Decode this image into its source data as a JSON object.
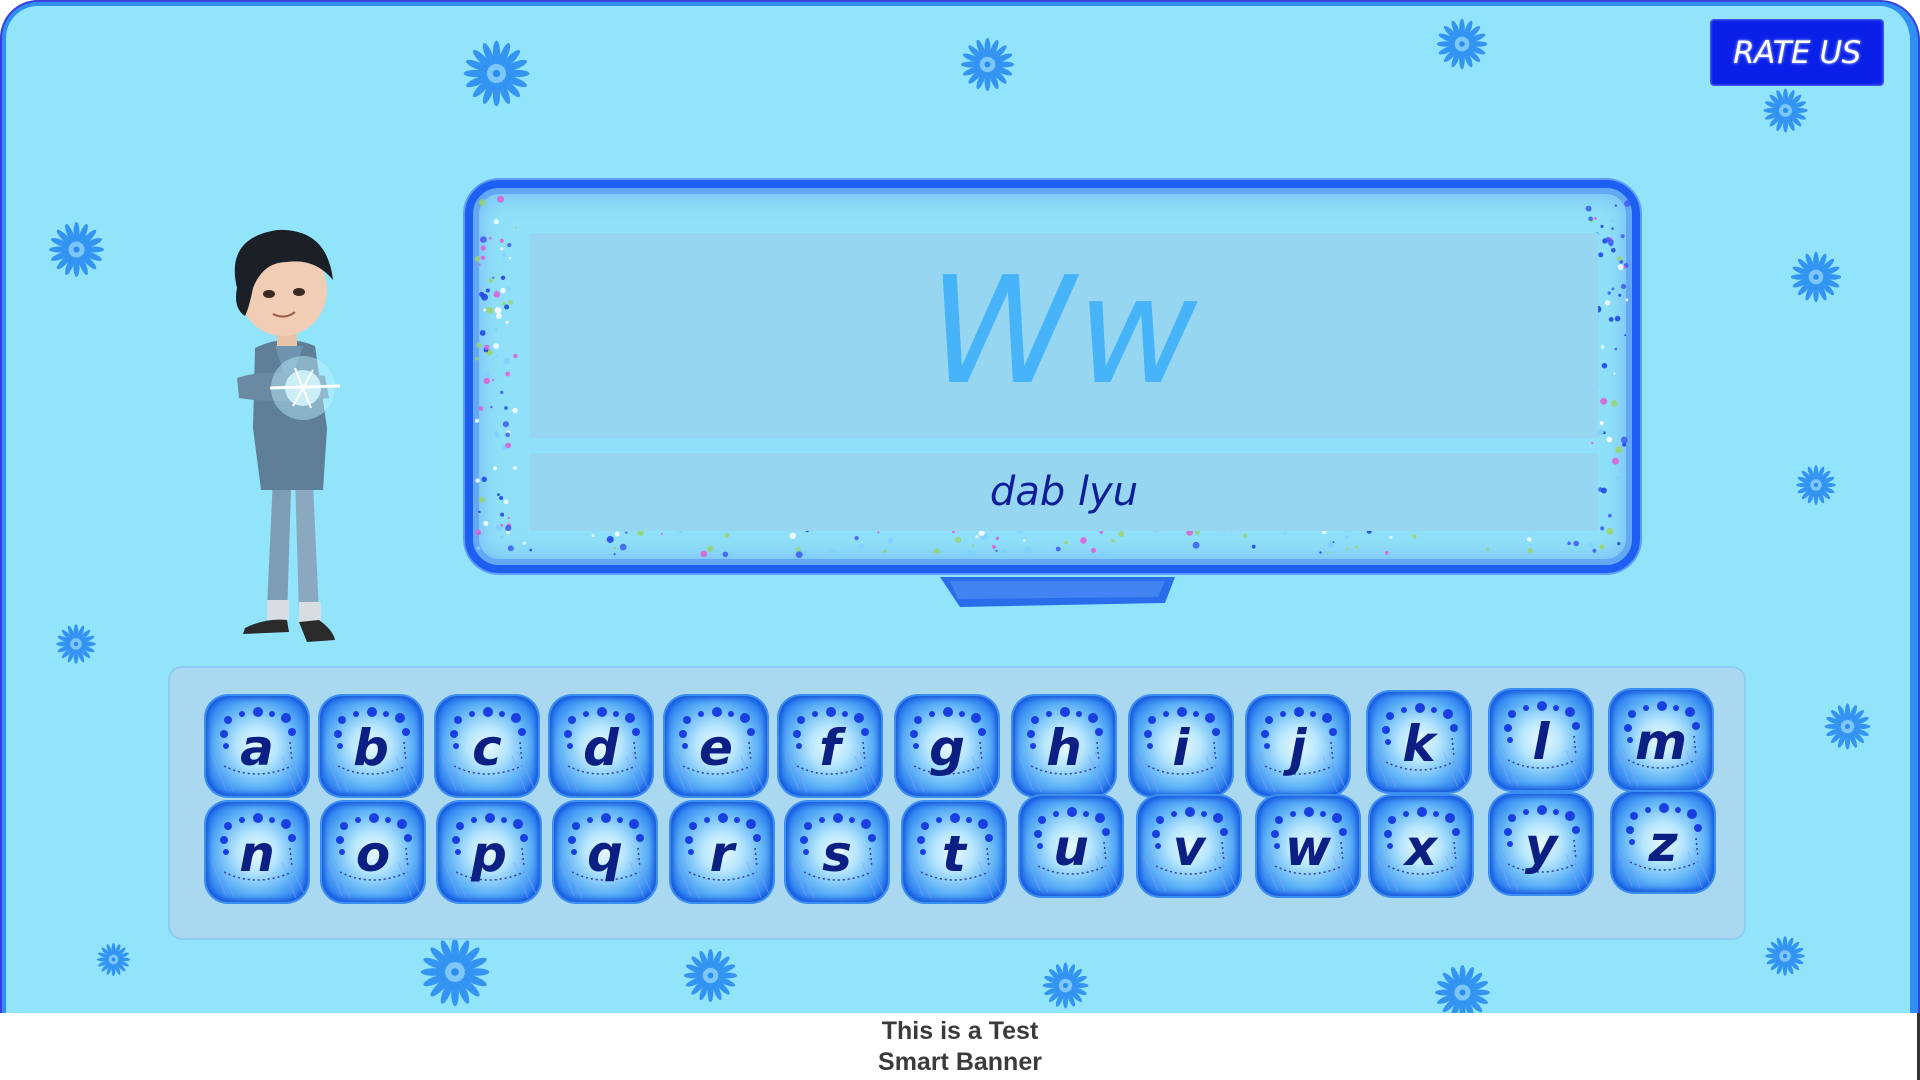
{
  "header": {
    "rate_us_label": "RATE US"
  },
  "display": {
    "letter": "Ww",
    "pronunciation": "dab lyu"
  },
  "keyboard": {
    "rows": [
      [
        "a",
        "b",
        "c",
        "d",
        "e",
        "f",
        "g",
        "h",
        "i",
        "j",
        "k",
        "l",
        "m"
      ],
      [
        "n",
        "o",
        "p",
        "q",
        "r",
        "s",
        "t",
        "u",
        "v",
        "w",
        "x",
        "y",
        "z"
      ]
    ]
  },
  "banner": {
    "line1": "This is a Test",
    "line2": "Smart Banner"
  },
  "icons": {
    "decoration": "flower-icon",
    "character": "boy-character"
  },
  "colors": {
    "background": "#92e4fb",
    "frame": "#2f8ff3",
    "rate_us": "#0a20e8",
    "big_letter": "#47b4f9",
    "word_text": "#0f1e96",
    "key_text": "#0c1f82"
  }
}
